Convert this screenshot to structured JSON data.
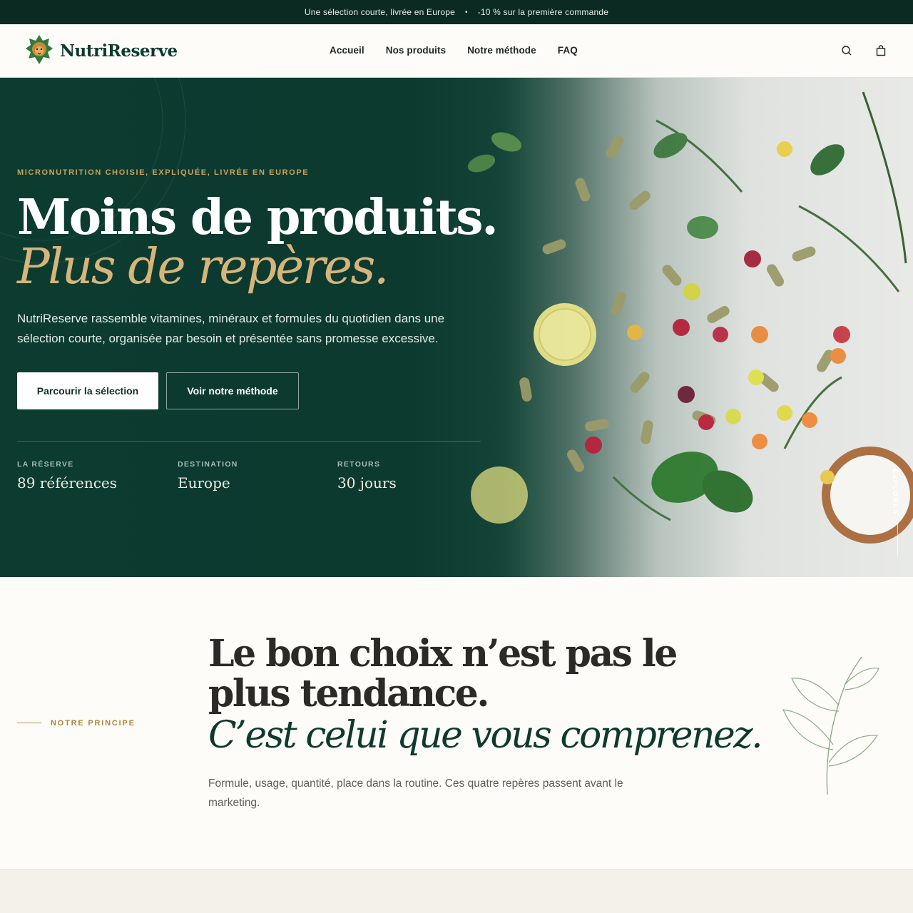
{
  "announcement": {
    "left": "Une sélection courte, livrée en Europe",
    "separator": "•",
    "right": "-10 % sur la première commande"
  },
  "header": {
    "brand": "NutriReserve",
    "nav": [
      "Accueil",
      "Nos produits",
      "Notre méthode",
      "FAQ"
    ],
    "icons": [
      "search-icon",
      "bag-icon"
    ]
  },
  "hero": {
    "eyebrow": "MICRONUTRITION CHOISIE, EXPLIQUÉE, LIVRÉE EN EUROPE",
    "title_line1": "Moins de produits.",
    "title_line2": "Plus de repères.",
    "lead": "NutriReserve rassemble vitamines, minéraux et formules du quotidien dans une sélection courte, organisée par besoin et présentée sans promesse excessive.",
    "cta_primary": "Parcourir la sélection",
    "cta_secondary": "Voir notre méthode",
    "stats": [
      {
        "label": "LA RÉSERVE",
        "value": "89 références"
      },
      {
        "label": "DESTINATION",
        "value": "Europe"
      },
      {
        "label": "RETOURS",
        "value": "30 jours"
      }
    ],
    "explore": "EXPLORER"
  },
  "principle": {
    "tag": "NOTRE PRINCIPE",
    "title": "Le bon choix n’est pas le plus tendance.",
    "title_italic": "C’est celui que vous comprenez.",
    "text": "Formule, usage, quantité, place dans la routine. Ces quatre repères passent avant le marketing."
  },
  "colors": {
    "hero_green": "#0c3b30",
    "accent_gold": "#c9a15e",
    "topbar": "#0a2a22"
  }
}
